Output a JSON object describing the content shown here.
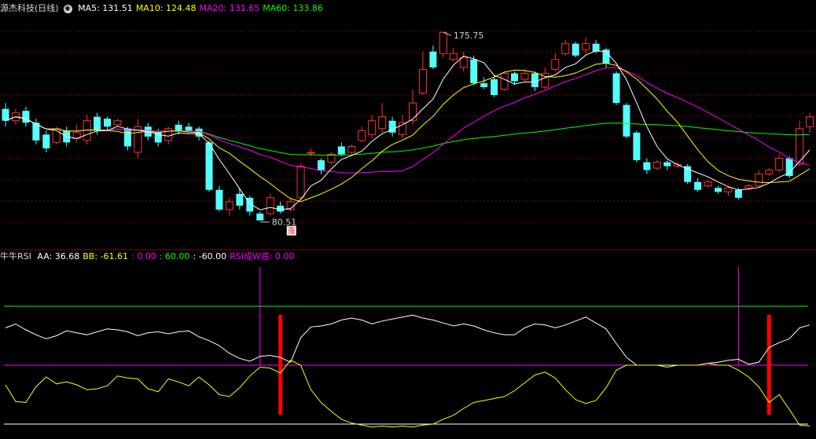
{
  "header": {
    "title": "源杰科技(日线)",
    "ma": [
      {
        "label": "MA5",
        "value": "131.51",
        "color": "#ffffff"
      },
      {
        "label": "MA10",
        "value": "124.48",
        "color": "#ffff00"
      },
      {
        "label": "MA20",
        "value": "131.65",
        "color": "#ff00ff"
      },
      {
        "label": "MA60",
        "value": "133.86",
        "color": "#00ff00"
      }
    ]
  },
  "indicator_header": {
    "name": "牛牛RSI",
    "items": [
      {
        "label": "AA:",
        "value": "36.68",
        "color": "#ffffff"
      },
      {
        "label": "BB:",
        "value": "-61.61",
        "color": "#ffff00"
      },
      {
        "label": ":",
        "value": "0.00",
        "color": "#ff00ff"
      },
      {
        "label": ":",
        "value": "60.00",
        "color": "#00ff00"
      },
      {
        "label": ":",
        "value": "-60.00",
        "color": "#ffffff"
      },
      {
        "label": "RSI成W底:",
        "value": "0.00",
        "color": "#ff00ff"
      }
    ]
  },
  "annotations": {
    "high_label": "175.75",
    "low_label": "80.51",
    "badge": "涨"
  },
  "colors": {
    "up": "#ff3232",
    "down": "#54ffff",
    "grid": "#8b0000",
    "ma5": "#ffffff",
    "ma10": "#ffff00",
    "ma20": "#ff00ff",
    "ma60": "#00ff00"
  },
  "chart_data": [
    {
      "type": "candlestick",
      "title": "源杰科技(日线)",
      "ylim": [
        76,
        186
      ],
      "candles": [
        [
          137,
          131,
          140,
          128
        ],
        [
          131,
          135,
          137,
          129
        ],
        [
          136,
          130,
          138,
          128
        ],
        [
          130,
          121,
          132,
          119
        ],
        [
          124,
          117,
          126,
          115
        ],
        [
          120,
          127,
          128,
          119
        ],
        [
          126,
          120,
          128,
          118
        ],
        [
          122,
          125,
          129,
          120
        ],
        [
          121,
          131,
          134,
          119
        ],
        [
          133,
          126,
          135,
          124
        ],
        [
          132,
          128,
          133,
          126
        ],
        [
          129,
          131,
          132,
          128
        ],
        [
          127,
          118,
          128,
          116
        ],
        [
          115,
          128,
          132,
          112
        ],
        [
          128,
          123,
          130,
          121
        ],
        [
          125,
          120,
          127,
          118
        ],
        [
          121,
          127,
          128,
          119
        ],
        [
          129,
          126,
          131,
          124
        ],
        [
          128,
          126,
          130,
          125
        ],
        [
          127,
          123,
          128,
          121
        ],
        [
          120,
          96,
          121,
          95
        ],
        [
          96,
          86,
          98,
          85
        ],
        [
          86,
          90,
          92,
          83
        ],
        [
          94,
          88,
          97,
          86
        ],
        [
          92,
          85,
          93,
          83
        ],
        [
          84,
          80.51,
          85,
          80.51
        ],
        [
          84,
          92,
          94,
          83
        ],
        [
          88,
          85,
          90,
          84
        ],
        [
          86,
          90,
          92,
          85
        ],
        [
          92,
          108,
          109,
          91
        ],
        [
          115,
          115,
          117,
          113
        ],
        [
          111,
          106,
          112,
          104
        ],
        [
          110,
          114,
          115,
          109
        ],
        [
          118,
          114,
          120,
          113
        ],
        [
          115,
          118,
          119,
          114
        ],
        [
          121,
          126,
          128,
          120
        ],
        [
          124,
          131,
          134,
          122
        ],
        [
          127,
          133,
          140,
          125
        ],
        [
          131,
          125,
          133,
          123
        ],
        [
          124,
          130,
          134,
          122
        ],
        [
          131,
          140,
          147,
          129
        ],
        [
          145,
          157,
          166,
          144
        ],
        [
          166,
          158,
          169,
          157
        ],
        [
          165,
          175.75,
          175.75,
          163
        ],
        [
          162,
          165,
          168,
          161
        ],
        [
          158,
          163,
          166,
          156
        ],
        [
          162,
          150,
          164,
          149
        ],
        [
          150,
          148,
          153,
          147
        ],
        [
          152,
          144,
          154,
          143
        ],
        [
          147,
          155,
          156,
          146
        ],
        [
          155,
          151,
          156,
          149
        ],
        [
          152,
          155,
          157,
          151
        ],
        [
          155,
          148,
          156,
          146
        ],
        [
          148,
          155,
          158,
          147
        ],
        [
          157,
          162,
          165,
          156
        ],
        [
          165,
          170,
          172,
          164
        ],
        [
          170,
          164,
          171,
          163
        ],
        [
          167,
          170,
          173,
          165
        ],
        [
          170,
          166,
          172,
          165
        ],
        [
          167,
          160,
          168,
          158
        ],
        [
          155,
          140,
          156,
          139
        ],
        [
          139,
          123,
          140,
          122
        ],
        [
          125,
          111,
          126,
          110
        ],
        [
          110,
          106,
          112,
          104
        ],
        [
          107,
          110,
          111,
          106
        ],
        [
          110,
          108,
          111,
          106
        ],
        [
          108,
          109,
          110,
          107
        ],
        [
          108,
          100,
          109,
          99
        ],
        [
          100,
          96,
          102,
          95
        ],
        [
          98,
          100,
          101,
          97
        ],
        [
          97,
          95,
          98,
          94
        ],
        [
          95,
          97,
          98,
          93
        ],
        [
          96,
          92,
          97,
          91
        ],
        [
          97,
          98,
          99,
          96
        ],
        [
          98,
          104,
          106,
          97
        ],
        [
          104,
          106,
          107,
          103
        ],
        [
          106,
          112,
          114,
          105
        ],
        [
          112,
          103,
          113,
          102
        ],
        [
          109,
          127,
          131,
          108
        ],
        [
          128,
          133,
          135,
          125
        ]
      ]
    },
    {
      "type": "line",
      "title": "牛牛RSI",
      "ylim": [
        -60,
        90
      ],
      "hlines": [
        60,
        0,
        -60
      ],
      "series": [
        {
          "name": "AA",
          "values": [
            38,
            42,
            36,
            31,
            27,
            30,
            35,
            33,
            31,
            34,
            37,
            36,
            34,
            30,
            33,
            34,
            32,
            34,
            35,
            29,
            25,
            20,
            12,
            7,
            4,
            9,
            10,
            8,
            3,
            28,
            39,
            40,
            42,
            46,
            48,
            46,
            42,
            45,
            47,
            49,
            51,
            48,
            46,
            43,
            40,
            42,
            40,
            36,
            33,
            31,
            31,
            38,
            42,
            41,
            38,
            41,
            45,
            49,
            43,
            37,
            22,
            8,
            0,
            0,
            0,
            0,
            0,
            0,
            0,
            2,
            3,
            5,
            6,
            1,
            3,
            18,
            23,
            27,
            38,
            41
          ]
        },
        {
          "name": "BB",
          "values": [
            -20,
            -37,
            -38,
            -22,
            -12,
            -19,
            -17,
            -20,
            -25,
            -24,
            -21,
            -11,
            -13,
            -14,
            -24,
            -27,
            -14,
            -17,
            -21,
            -12,
            -20,
            -30,
            -32,
            -23,
            -11,
            -2,
            -3,
            -8,
            5,
            0,
            -25,
            -38,
            -47,
            -55,
            -59,
            -61,
            -63,
            -62,
            -63,
            -62,
            -63,
            -61,
            -60,
            -55,
            -51,
            -44,
            -38,
            -36,
            -34,
            -32,
            -26,
            -18,
            -10,
            -7,
            -13,
            -25,
            -35,
            -39,
            -36,
            -23,
            -5,
            0,
            0,
            0,
            0,
            -2,
            0,
            0,
            0,
            2,
            0,
            0,
            -5,
            -12,
            -22,
            -38,
            -30,
            -45,
            -61,
            -62
          ]
        },
        {
          "name": "RSI成W底",
          "values": [
            0,
            0,
            0,
            0,
            0,
            0,
            0,
            0,
            0,
            0,
            0,
            0,
            0,
            0,
            0,
            0,
            0,
            0,
            0,
            0,
            0,
            0,
            0,
            0,
            0,
            0,
            0,
            0,
            0,
            0,
            0,
            0,
            0,
            0,
            0,
            0,
            0,
            0,
            0,
            0,
            0,
            0,
            0,
            0,
            0,
            0,
            0,
            0,
            0,
            0,
            0,
            0,
            0,
            0,
            0,
            0,
            0,
            0,
            0,
            0,
            0,
            0,
            0,
            0,
            0,
            0,
            0,
            0,
            0,
            0,
            0,
            0,
            0,
            0,
            0,
            0,
            0,
            0,
            0,
            0
          ]
        }
      ],
      "signals": [
        27,
        75
      ],
      "markers": [
        25,
        72
      ]
    }
  ]
}
